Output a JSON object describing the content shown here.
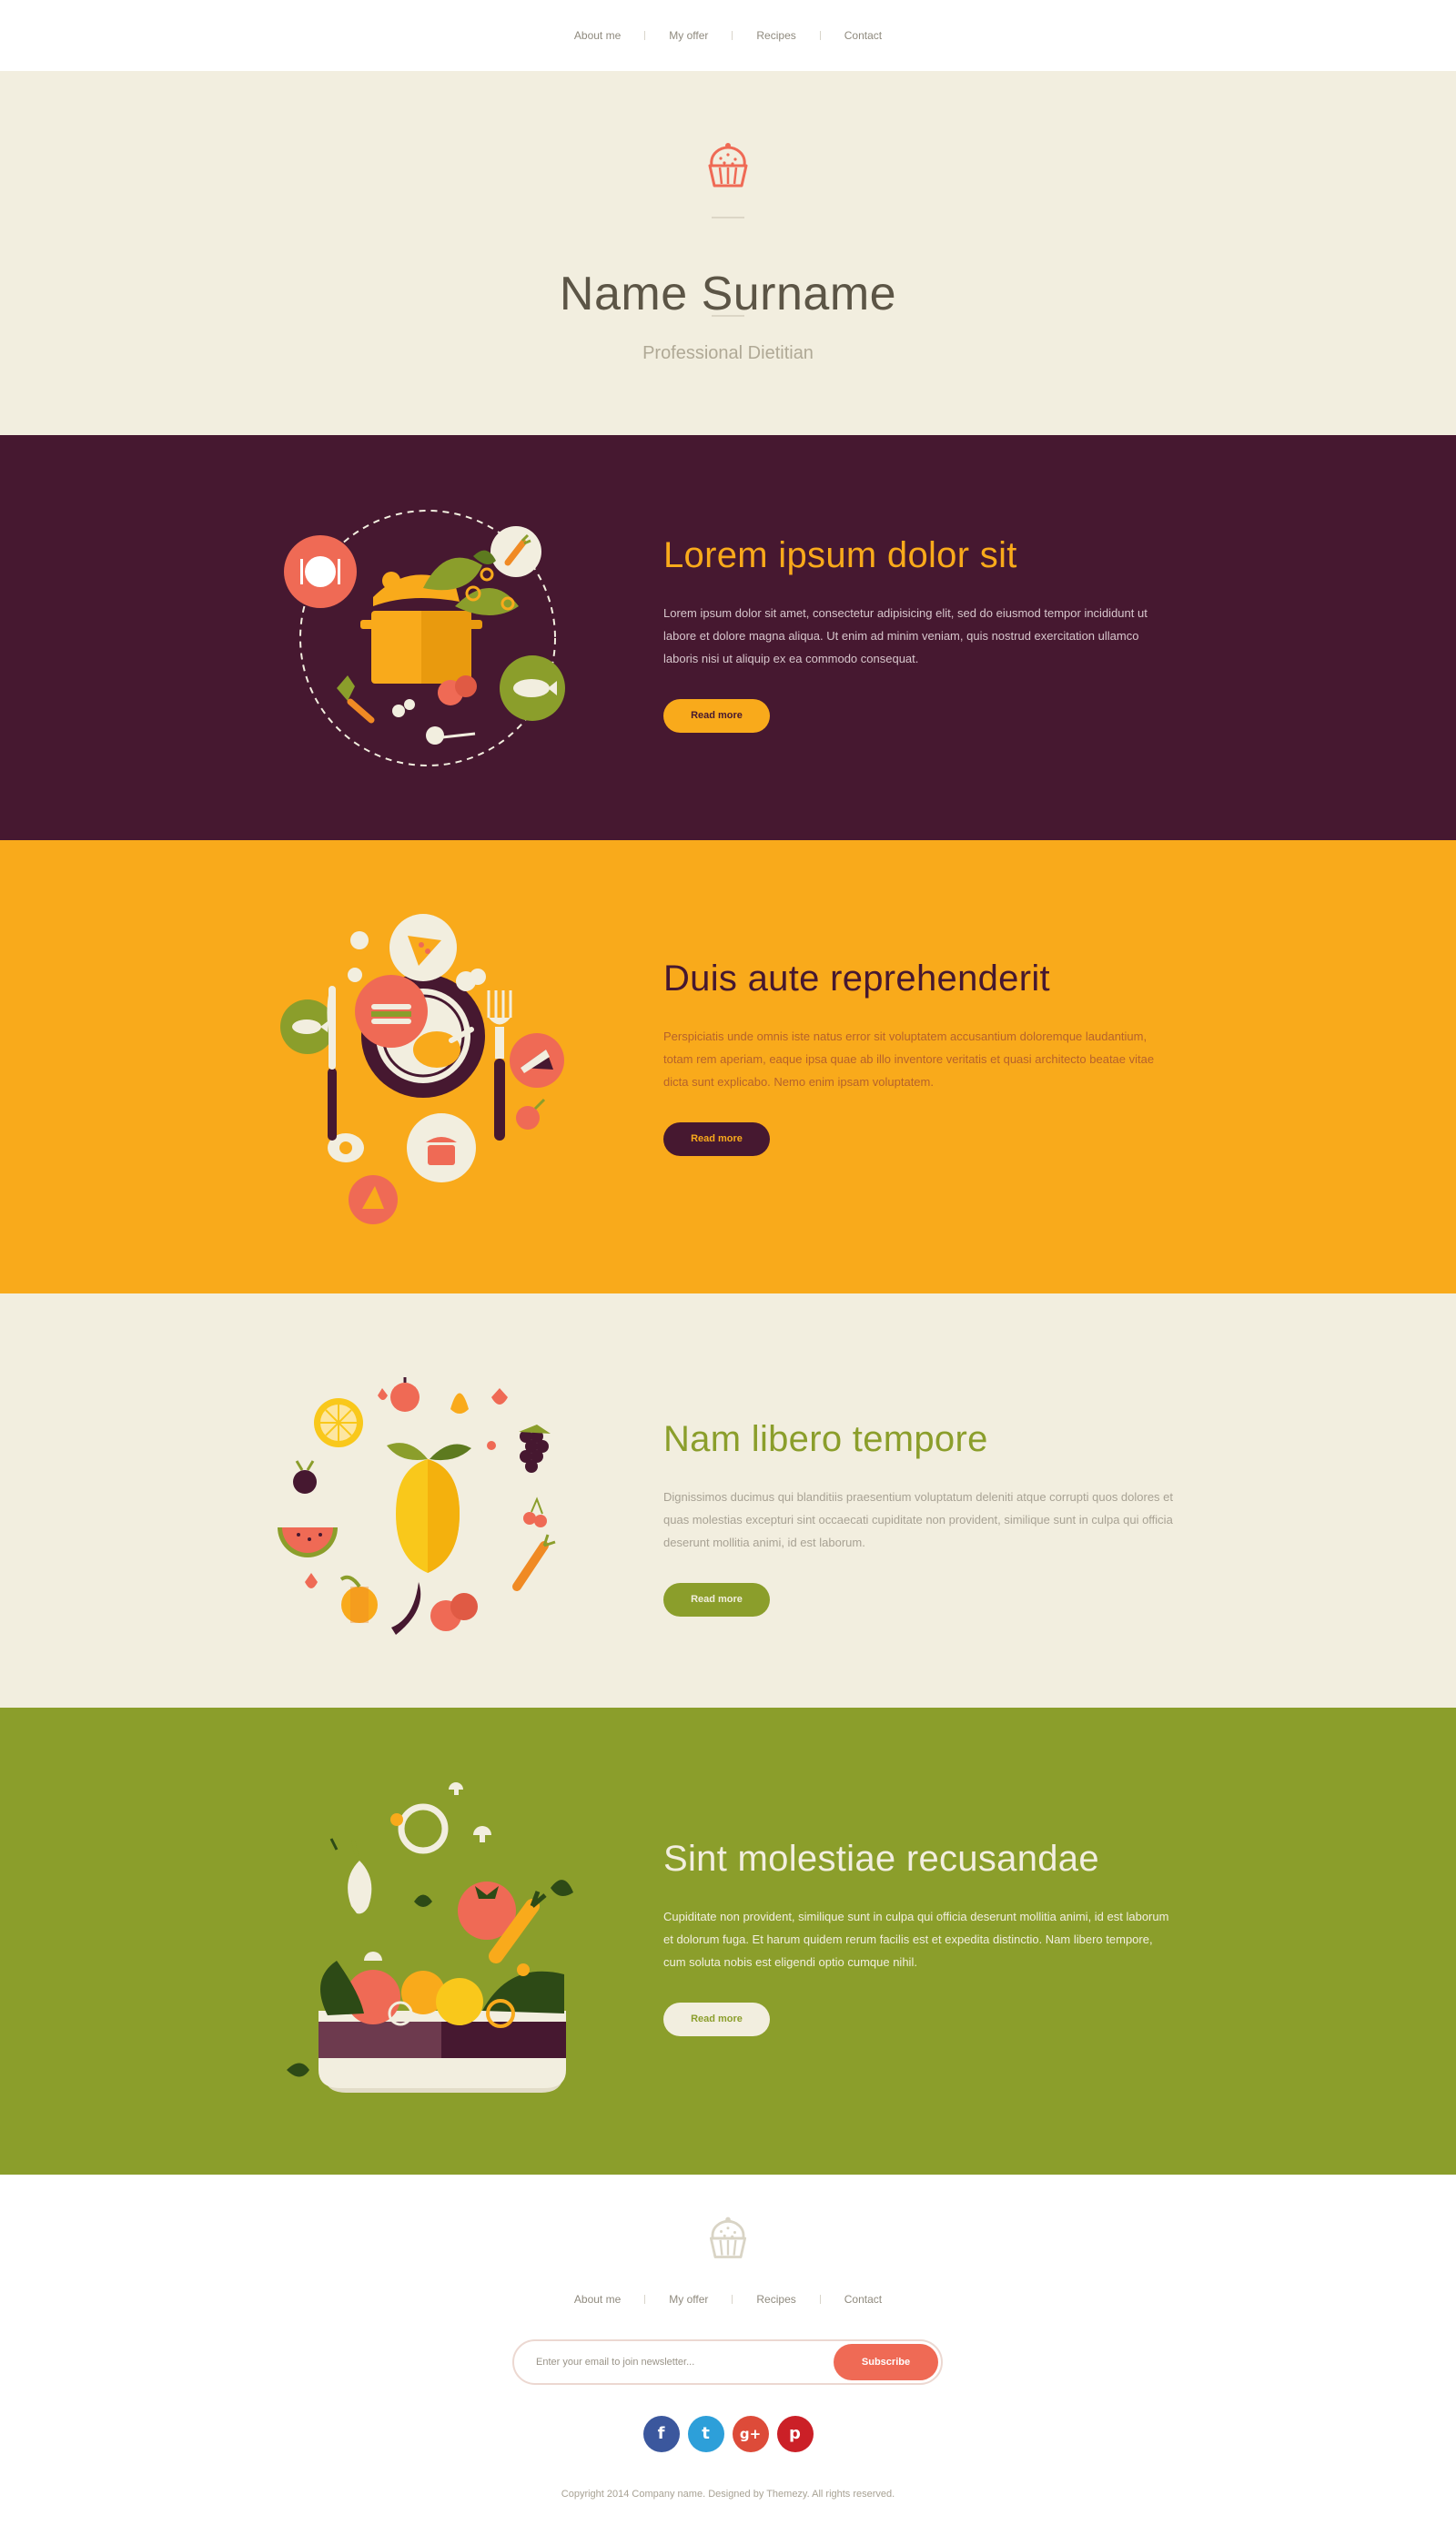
{
  "nav": {
    "items": [
      "About me",
      "My offer",
      "Recipes",
      "Contact"
    ]
  },
  "hero": {
    "title": "Name Surname",
    "subtitle": "Professional Dietitian",
    "logo_icon": "cupcake-icon"
  },
  "sections": [
    {
      "title": "Lorem ipsum dolor sit",
      "text": "Lorem ipsum dolor sit amet, consectetur adipisicing elit, sed do eiusmod tempor incididunt ut labore et dolore magna aliqua. Ut enim ad minim veniam, quis nostrud exercitation ullamco laboris nisi ut aliquip ex ea commodo consequat.",
      "button": "Read more",
      "illustration": "cooking-pot-illustration",
      "colors": {
        "bg": "#461830",
        "title": "#f9aa1b",
        "text": "#d7c6cc",
        "button_bg": "#f9aa1b",
        "button_text": "#461830"
      }
    },
    {
      "title": "Duis aute reprehenderit",
      "text": "Perspiciatis unde omnis iste natus error sit voluptatem accusantium doloremque laudantium, totam rem aperiam, eaque ipsa quae ab illo inventore veritatis et quasi architecto beatae vitae dicta sunt explicabo. Nemo enim ipsam voluptatem.",
      "button": "Read more",
      "illustration": "dinner-plate-illustration",
      "colors": {
        "bg": "#f9aa1b",
        "title": "#461830",
        "text": "#b6622c",
        "button_bg": "#461830",
        "button_text": "#f9aa1b"
      }
    },
    {
      "title": "Nam libero tempore",
      "text": "Dignissimos ducimus qui blanditiis praesentium voluptatum deleniti atque corrupti quos dolores et quas molestias excepturi sint occaecati cupiditate non provident, similique sunt in culpa qui officia deserunt mollitia animi, id est laborum.",
      "button": "Read more",
      "illustration": "fruits-circle-illustration",
      "colors": {
        "bg": "#f2eedf",
        "title": "#8b9e2b",
        "text": "#a8a294",
        "button_bg": "#8b9e2b",
        "button_text": "#f2eedf"
      }
    },
    {
      "title": "Sint molestiae recusandae",
      "text": "Cupiditate non provident, similique sunt in culpa qui officia deserunt mollitia animi, id est laborum et dolorum fuga. Et harum quidem rerum facilis est et expedita distinctio. Nam libero tempore, cum soluta nobis est eligendi optio cumque nihil.",
      "button": "Read more",
      "illustration": "salad-bowl-illustration",
      "colors": {
        "bg": "#8b9e2b",
        "title": "#f2eedf",
        "text": "#f2eedf",
        "button_bg": "#f2eedf",
        "button_text": "#8b9e2b"
      }
    }
  ],
  "footer": {
    "newsletter_placeholder": "Enter your email to join newsletter...",
    "subscribe_label": "Subscribe",
    "socials": [
      {
        "icon": "facebook-icon",
        "glyph": "f",
        "color": "#3b579d"
      },
      {
        "icon": "twitter-icon",
        "glyph": "t",
        "color": "#2d9fd9"
      },
      {
        "icon": "google-plus-icon",
        "glyph": "g+",
        "color": "#dd4b39"
      },
      {
        "icon": "pinterest-icon",
        "glyph": "p",
        "color": "#cb2027"
      }
    ],
    "copyright": "Copyright 2014 Company name. Designed by Themezy. All rights reserved."
  }
}
